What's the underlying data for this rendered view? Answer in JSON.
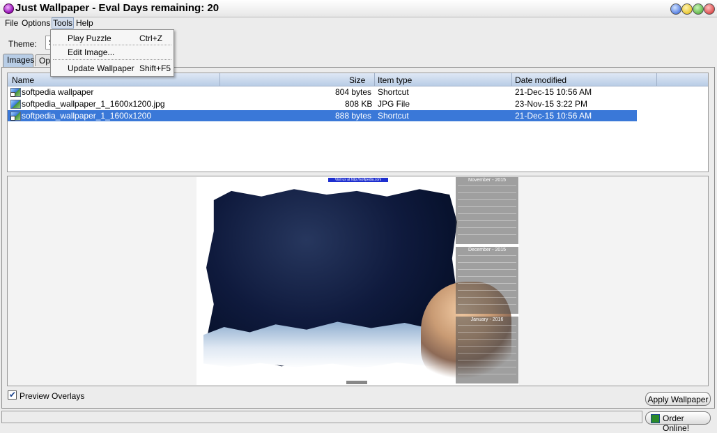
{
  "window": {
    "title": "Just Wallpaper - Eval Days remaining: 20"
  },
  "menubar": {
    "file": "File",
    "options": "Options",
    "tools": "Tools",
    "help": "Help"
  },
  "tools_menu": [
    {
      "label": "Play Puzzle",
      "shortcut": "Ctrl+Z"
    },
    {
      "label": "Edit Image...",
      "shortcut": ""
    },
    {
      "label": "Update Wallpaper",
      "shortcut": "Shift+F5"
    }
  ],
  "theme": {
    "label": "Theme:",
    "value": "S"
  },
  "tabs": [
    {
      "label": "Images"
    },
    {
      "label": "Opt"
    }
  ],
  "file_list": {
    "columns": [
      "Name",
      "Size",
      "Item type",
      "Date modified"
    ],
    "rows": [
      {
        "name": "softpedia wallpaper",
        "size": "804 bytes",
        "type": "Shortcut",
        "date": "21-Dec-15 10:56 AM"
      },
      {
        "name": "softpedia_wallpaper_1_1600x1200.jpg",
        "size": "808 KB",
        "type": "JPG File",
        "date": "23-Nov-15 3:22 PM"
      },
      {
        "name": "softpedia_wallpaper_1_1600x1200",
        "size": "888 bytes",
        "type": "Shortcut",
        "date": "21-Dec-15 10:56 AM"
      }
    ]
  },
  "preview": {
    "url_strip": "Visit us at http://softpedia.com",
    "calendars": [
      "November - 2015",
      "December - 2015",
      "January - 2016"
    ]
  },
  "preview_overlays": {
    "label": "Preview Overlays",
    "checked": true
  },
  "buttons": {
    "apply": "Apply Wallpaper",
    "order": "Order Online!"
  },
  "colors": {
    "selection": "#3a78d8",
    "header": "#b9cde6",
    "tab_selected": "#b8cde6"
  }
}
